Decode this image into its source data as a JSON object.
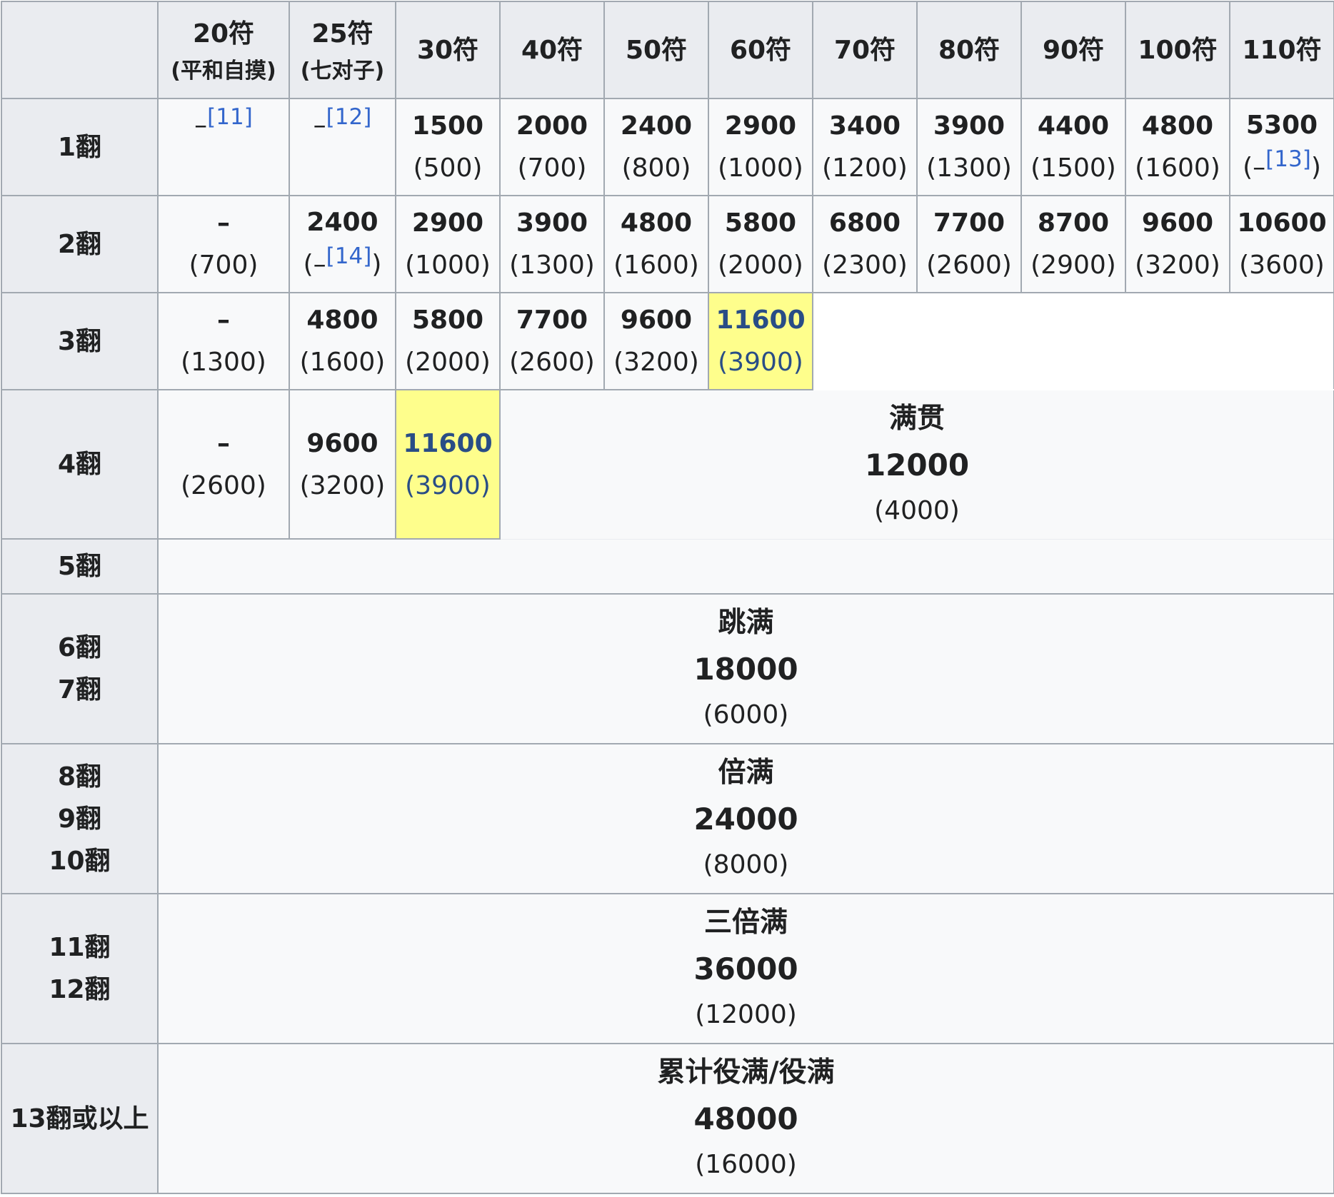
{
  "corner": "",
  "headers": [
    {
      "label": "20符",
      "sub": "(平和自摸)"
    },
    {
      "label": "25符",
      "sub": "(七对子)"
    },
    {
      "label": "30符"
    },
    {
      "label": "40符"
    },
    {
      "label": "50符"
    },
    {
      "label": "60符"
    },
    {
      "label": "70符"
    },
    {
      "label": "80符"
    },
    {
      "label": "90符"
    },
    {
      "label": "100符"
    },
    {
      "label": "110符"
    }
  ],
  "rows": {
    "han1": {
      "label": "1翻",
      "c20": {
        "dash": "–",
        "ref": "[11]"
      },
      "c25": {
        "dash": "–",
        "ref": "[12]"
      },
      "c30": {
        "pts": "1500",
        "half": "(500)"
      },
      "c40": {
        "pts": "2000",
        "half": "(700)"
      },
      "c50": {
        "pts": "2400",
        "half": "(800)"
      },
      "c60": {
        "pts": "2900",
        "half": "(1000)"
      },
      "c70": {
        "pts": "3400",
        "half": "(1200)"
      },
      "c80": {
        "pts": "3900",
        "half": "(1300)"
      },
      "c90": {
        "pts": "4400",
        "half": "(1500)"
      },
      "c100": {
        "pts": "4800",
        "half": "(1600)"
      },
      "c110": {
        "pts": "5300",
        "open": "(–",
        "ref": "[13]",
        "close": ")"
      }
    },
    "han2": {
      "label": "2翻",
      "c20": {
        "pts": "–",
        "half": "(700)"
      },
      "c25": {
        "pts": "2400",
        "open": "(–",
        "ref": "[14]",
        "close": ")"
      },
      "c30": {
        "pts": "2900",
        "half": "(1000)"
      },
      "c40": {
        "pts": "3900",
        "half": "(1300)"
      },
      "c50": {
        "pts": "4800",
        "half": "(1600)"
      },
      "c60": {
        "pts": "5800",
        "half": "(2000)"
      },
      "c70": {
        "pts": "6800",
        "half": "(2300)"
      },
      "c80": {
        "pts": "7700",
        "half": "(2600)"
      },
      "c90": {
        "pts": "8700",
        "half": "(2900)"
      },
      "c100": {
        "pts": "9600",
        "half": "(3200)"
      },
      "c110": {
        "pts": "10600",
        "half": "(3600)"
      }
    },
    "han3": {
      "label": "3翻",
      "c20": {
        "pts": "–",
        "half": "(1300)"
      },
      "c25": {
        "pts": "4800",
        "half": "(1600)"
      },
      "c30": {
        "pts": "5800",
        "half": "(2000)"
      },
      "c40": {
        "pts": "7700",
        "half": "(2600)"
      },
      "c50": {
        "pts": "9600",
        "half": "(3200)"
      },
      "c60": {
        "pts": "11600",
        "half": "(3900)"
      }
    },
    "han4": {
      "label": "4翻",
      "c20": {
        "pts": "–",
        "half": "(2600)"
      },
      "c25": {
        "pts": "9600",
        "half": "(3200)"
      },
      "c30": {
        "pts": "11600",
        "half": "(3900)"
      }
    },
    "han5": {
      "label": "5翻"
    },
    "han6_7": {
      "label1": "6翻",
      "label2": "7翻"
    },
    "han8_10": {
      "label1": "8翻",
      "label2": "9翻",
      "label3": "10翻"
    },
    "han11_12": {
      "label1": "11翻",
      "label2": "12翻"
    },
    "han13": {
      "label": "13翻或以上"
    }
  },
  "limits": {
    "mangan": {
      "name": "满贯",
      "pts": "12000",
      "half": "(4000)"
    },
    "haneman": {
      "name": "跳满",
      "pts": "18000",
      "half": "(6000)"
    },
    "baiman": {
      "name": "倍满",
      "pts": "24000",
      "half": "(8000)"
    },
    "sanbaiman": {
      "name": "三倍满",
      "pts": "36000",
      "half": "(12000)"
    },
    "yakuman": {
      "name": "累计役满/役满",
      "pts": "48000",
      "half": "(16000)"
    }
  },
  "colors": {
    "header_bg": "#eaecf0",
    "cell_bg": "#f8f9fa",
    "highlight_bg": "#fefe8c",
    "highlight_text": "#294d86",
    "border": "#a2a9b1",
    "link": "#3366cc"
  }
}
